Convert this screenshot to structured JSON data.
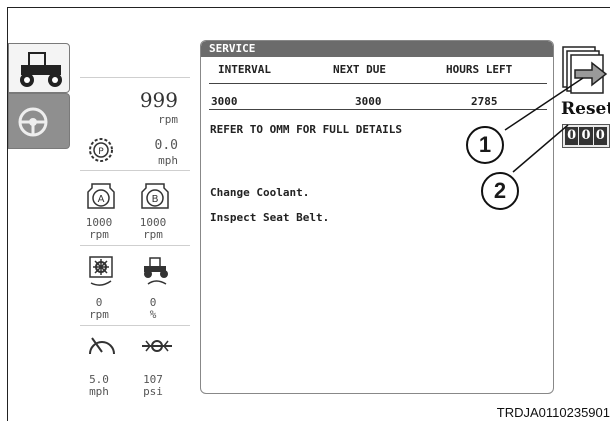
{
  "service": {
    "title": "SERVICE",
    "columns": [
      "INTERVAL",
      "NEXT DUE",
      "HOURS LEFT"
    ],
    "row": [
      "3000",
      "3000",
      "2785"
    ],
    "note": "REFER TO OMM FOR FULL DETAILS",
    "tasks": [
      "Change Coolant.",
      "Inspect Seat Belt."
    ]
  },
  "side": {
    "engine_rpm": "999",
    "engine_rpm_unit": "rpm",
    "speed": "0.0",
    "speed_unit": "mph",
    "pto_a": "1000",
    "pto_a_unit": "rpm",
    "pto_b": "1000",
    "pto_b_unit": "rpm",
    "gauge_c": "0",
    "gauge_c_unit": "rpm",
    "gauge_d": "0",
    "gauge_d_unit": "%",
    "gauge_e": "5.0",
    "gauge_e_unit": "mph",
    "gauge_f": "107",
    "gauge_f_unit": "psi",
    "pto_a_letter": "A",
    "pto_b_letter": "B",
    "park_letter": "P"
  },
  "right": {
    "reset_label": "Reset",
    "counter": [
      "0",
      "0",
      "0"
    ]
  },
  "callouts": [
    "1",
    "2"
  ],
  "reference": "TRDJA0110235901"
}
